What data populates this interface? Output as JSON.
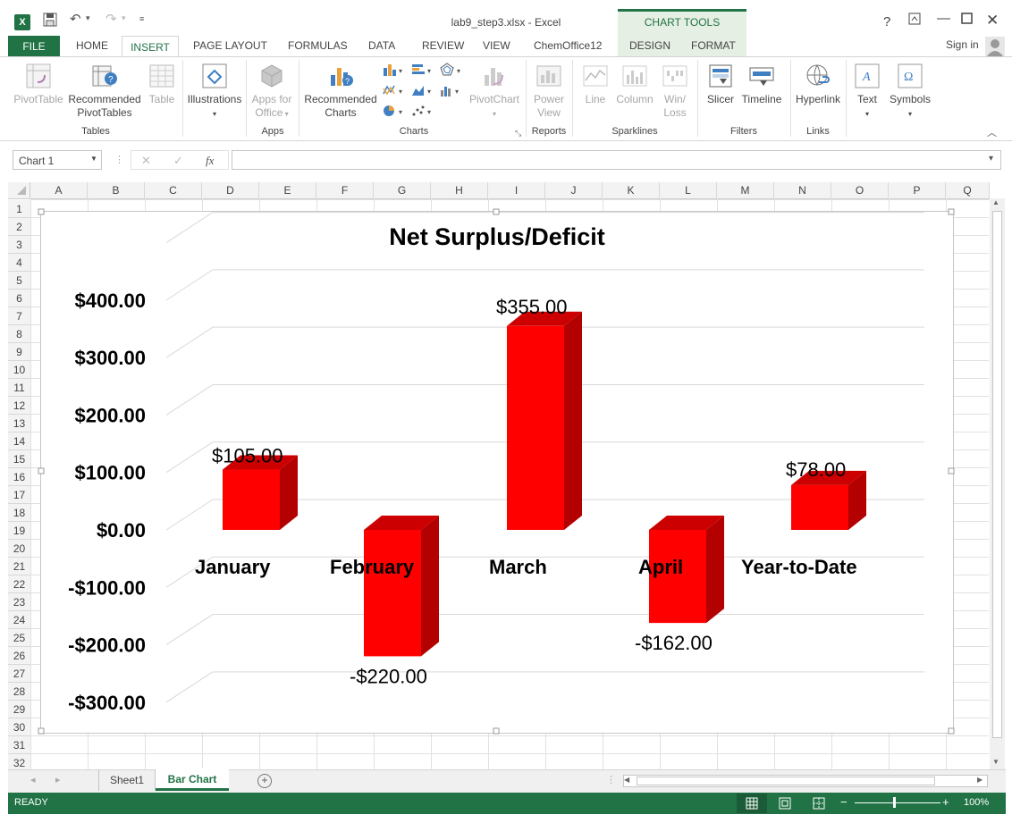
{
  "window": {
    "title": "lab9_step3.xlsx - Excel",
    "context_tab_group": "CHART TOOLS",
    "help": "?",
    "signin": "Sign in"
  },
  "tabs": {
    "file": "FILE",
    "home": "HOME",
    "insert": "INSERT",
    "page_layout": "PAGE LAYOUT",
    "formulas": "FORMULAS",
    "data": "DATA",
    "review": "REVIEW",
    "view": "VIEW",
    "chemoffice": "ChemOffice12",
    "design": "DESIGN",
    "format": "FORMAT"
  },
  "ribbon": {
    "pivottable": "PivotTable",
    "recommended_pivottables": [
      "Recommended",
      "PivotTables"
    ],
    "table": "Table",
    "illustrations": "Illustrations",
    "apps_for_office": [
      "Apps for",
      "Office"
    ],
    "recommended_charts": [
      "Recommended",
      "Charts"
    ],
    "pivotchart": "PivotChart",
    "power_view": [
      "Power",
      "View"
    ],
    "line": "Line",
    "column": "Column",
    "winloss": [
      "Win/",
      "Loss"
    ],
    "slicer": "Slicer",
    "timeline": "Timeline",
    "hyperlink": "Hyperlink",
    "text": "Text",
    "symbols": "Symbols",
    "groups": {
      "tables": "Tables",
      "apps": "Apps",
      "charts": "Charts",
      "reports": "Reports",
      "sparklines": "Sparklines",
      "filters": "Filters",
      "links": "Links"
    }
  },
  "formula_bar": {
    "name_box": "Chart 1",
    "fx": "fx",
    "formula": ""
  },
  "grid": {
    "columns": [
      "A",
      "B",
      "C",
      "D",
      "E",
      "F",
      "G",
      "H",
      "I",
      "J",
      "K",
      "L",
      "M",
      "N",
      "O",
      "P",
      "Q"
    ],
    "rows": [
      "1",
      "2",
      "3",
      "4",
      "5",
      "6",
      "7",
      "8",
      "9",
      "10",
      "11",
      "12",
      "13",
      "14",
      "15",
      "16",
      "17",
      "18",
      "19",
      "20",
      "21",
      "22",
      "23",
      "24",
      "25",
      "26",
      "27",
      "28",
      "29",
      "30",
      "31",
      "32"
    ]
  },
  "chart_data": {
    "type": "bar",
    "title": "Net Surplus/Deficit",
    "categories": [
      "January",
      "February",
      "March",
      "April",
      "Year-to-Date"
    ],
    "values": [
      105,
      -220,
      355,
      -162,
      78
    ],
    "data_labels": [
      "$105.00",
      "-$220.00",
      "$355.00",
      "-$162.00",
      "$78.00"
    ],
    "ylim": [
      -300,
      400
    ],
    "yticks": [
      "$400.00",
      "$300.00",
      "$200.00",
      "$100.00",
      "$0.00",
      "-$100.00",
      "-$200.00",
      "-$300.00"
    ],
    "ytick_values": [
      400,
      300,
      200,
      100,
      0,
      -100,
      -200,
      -300
    ],
    "bar_color": "#ff0000",
    "grid": true,
    "legend": "none",
    "style": "3d-column"
  },
  "sheets": {
    "tabs": [
      "Sheet1",
      "Bar Chart"
    ],
    "active": "Bar Chart"
  },
  "status": {
    "ready": "READY",
    "zoom": "100%"
  },
  "colors": {
    "excel_green": "#217346"
  }
}
